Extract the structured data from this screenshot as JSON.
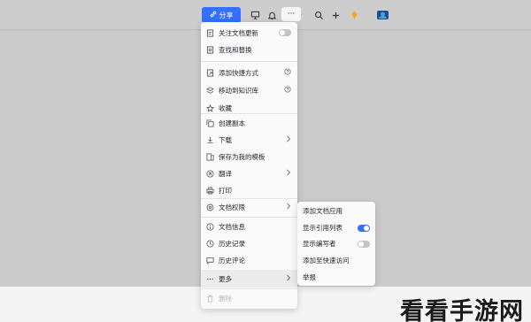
{
  "toolbar": {
    "share_label": "分享",
    "more_glyph": "···"
  },
  "menu": {
    "items": [
      {
        "label": "关注文档更新",
        "icon": "follow-icon",
        "right": "toggle-off"
      },
      {
        "label": "查找和替换",
        "icon": "find-replace-icon"
      },
      {
        "label": "添加快捷方式",
        "icon": "shortcut-icon",
        "right": "help"
      },
      {
        "label": "移动到知识库",
        "icon": "move-to-wiki-icon",
        "right": "help"
      },
      {
        "label": "收藏",
        "icon": "star-icon"
      },
      {
        "label": "创建副本",
        "icon": "copy-icon"
      },
      {
        "label": "下载",
        "icon": "download-icon",
        "right": "chevron"
      },
      {
        "label": "保存为我的模板",
        "icon": "template-icon"
      },
      {
        "label": "翻译",
        "icon": "translate-icon",
        "right": "chevron"
      },
      {
        "label": "打印",
        "icon": "print-icon"
      },
      {
        "label": "文档权限",
        "icon": "permission-icon",
        "right": "chevron"
      },
      {
        "label": "文档信息",
        "icon": "info-icon"
      },
      {
        "label": "历史记录",
        "icon": "history-icon"
      },
      {
        "label": "历史评论",
        "icon": "comment-history-icon"
      },
      {
        "label": "更多",
        "icon": "more-icon",
        "right": "chevron"
      },
      {
        "label": "删除",
        "icon": "delete-icon"
      }
    ]
  },
  "submenu": {
    "items": [
      {
        "label": "添加文档应用"
      },
      {
        "label": "显示引用列表",
        "right": "toggle-on"
      },
      {
        "label": "显示编写者",
        "right": "toggle-off"
      },
      {
        "label": "添加至快速访问"
      },
      {
        "label": "举报"
      }
    ]
  },
  "watermark": "看看手游网",
  "colors": {
    "accent": "#3370ff"
  }
}
